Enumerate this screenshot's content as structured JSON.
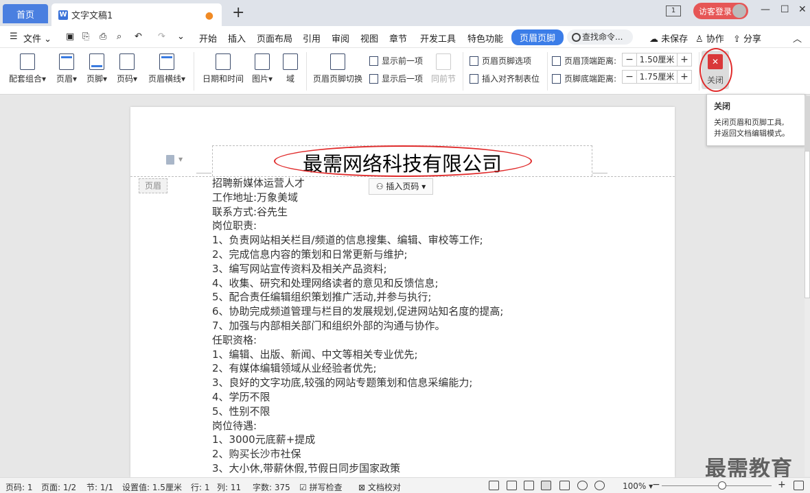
{
  "titlebar": {
    "home_tab": "首页",
    "doc_tab": "文字文稿1",
    "doc_icon": "W",
    "new_tab": "+",
    "layout_badge": "1",
    "login": "访客登录",
    "win_min": "—",
    "win_max": "☐",
    "win_close": "✕"
  },
  "menu": {
    "hamburger": "☰",
    "file": "文件",
    "items": [
      "开始",
      "插入",
      "页面布局",
      "引用",
      "审阅",
      "视图",
      "章节",
      "开发工具",
      "特色功能"
    ],
    "active": "页眉页脚",
    "search": "查找命令...",
    "unsaved": "未保存",
    "collab": "协作",
    "share": "分享",
    "collapse": "︿"
  },
  "ribbon": {
    "combo": "配套组合",
    "header": "页眉",
    "footer": "页脚",
    "pagenum": "页码",
    "header_line": "页眉横线",
    "datetime": "日期和时间",
    "picture": "图片",
    "field": "域",
    "switch": "页眉页脚切换",
    "show_prev": "显示前一项",
    "show_next": "显示后一项",
    "same_prev": "同前节",
    "options": "页眉页脚选项",
    "insert_align": "插入对齐制表位",
    "top_dist_label": "页眉顶端距离:",
    "top_dist": "1.50厘米",
    "bottom_dist_label": "页脚底端距离:",
    "bottom_dist": "1.75厘米",
    "close": "关闭",
    "minus": "−",
    "plus": "+"
  },
  "tooltip": {
    "title": "关闭",
    "line1": "关闭页眉和页脚工具,",
    "line2": "并返回文档编辑模式。"
  },
  "document": {
    "company": "最需网络科技有限公司",
    "header_tag": "页眉",
    "insert_page_num": "插入页码",
    "lines": [
      "招聘新媒体运营人才",
      "工作地址:万象美域",
      "联系方式:谷先生",
      "岗位职责:",
      "1、负责网站相关栏目/频道的信息搜集、编辑、审校等工作;",
      "2、完成信息内容的策划和日常更新与维护;",
      "3、编写网站宣传资料及相关产品资料;",
      "4、收集、研究和处理网络读者的意见和反馈信息;",
      "5、配合责任编辑组织策划推广活动,并参与执行;",
      "6、协助完成频道管理与栏目的发展规划,促进网站知名度的提高;",
      "7、加强与内部相关部门和组织外部的沟通与协作。",
      "任职资格:",
      "1、编辑、出版、新闻、中文等相关专业优先;",
      "2、有媒体编辑领域从业经验者优先;",
      "3、良好的文字功底,较强的网站专题策划和信息采编能力;",
      "4、学历不限",
      "5、性别不限",
      "岗位待遇:",
      "1、3000元底薪+提成",
      "2、购买长沙市社保",
      "3、大小休,带薪休假,节假日同步国家政策"
    ]
  },
  "status": {
    "page": "页码: 1",
    "pages": "页面: 1/2",
    "section": "节: 1/1",
    "setting": "设置值: 1.5厘米",
    "row": "行: 1",
    "col": "列: 11",
    "words": "字数: 375",
    "spell": "拼写检查",
    "proof": "文档校对",
    "zoom": "100%",
    "zoom_minus": "−",
    "zoom_plus": "+"
  },
  "watermark": "最需教育"
}
